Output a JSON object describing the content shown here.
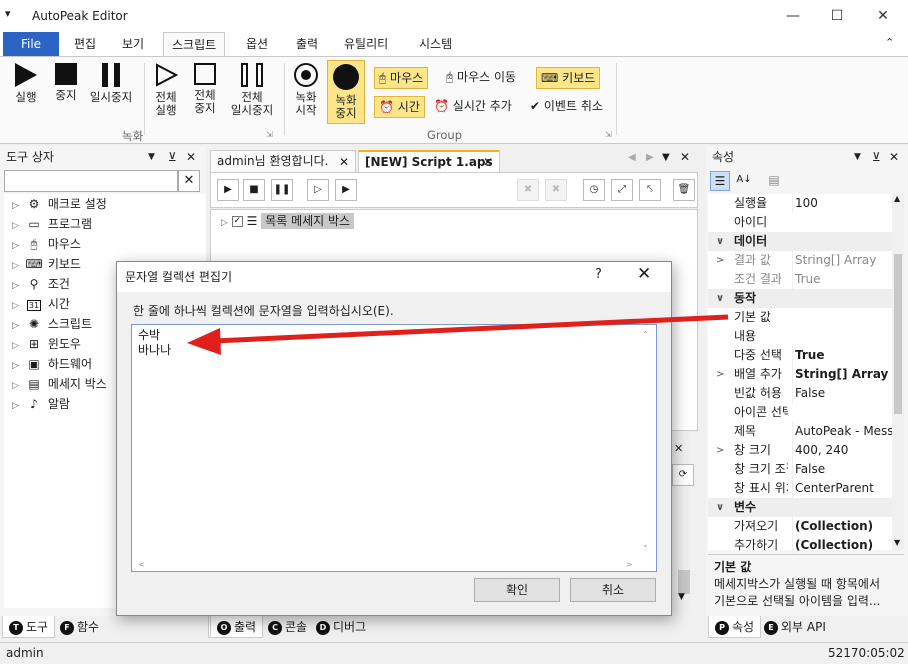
{
  "window": {
    "title": "AutoPeak Editor"
  },
  "ribbon_tabs": [
    "File",
    "편집",
    "보기",
    "스크립트",
    "옵션",
    "출력",
    "유틸리티",
    "시스템"
  ],
  "ribbon": {
    "run": "실행",
    "stop": "중지",
    "pause": "일시중지",
    "run_all_1": "전체",
    "run_all_2": "실행",
    "stop_all_1": "전체",
    "stop_all_2": "중지",
    "pause_all_1": "전체",
    "pause_all_2": "일시중지",
    "record_group_label": "녹화",
    "rec_start_1": "녹화",
    "rec_start_2": "시작",
    "rec_stop_1": "녹화",
    "rec_stop_2": "중지",
    "mouse": "마우스",
    "mouse_move": "마우스 이동",
    "keyboard": "키보드",
    "time": "시간",
    "realtime_add": "실시간 추가",
    "event_cancel": "이벤트 취소",
    "group_label": "Group"
  },
  "left_panel": {
    "title": "도구 상자",
    "items": [
      "매크로 설정",
      "프로그램",
      "마우스",
      "키보드",
      "조건",
      "시간",
      "스크립트",
      "윈도우",
      "하드웨어",
      "메세지 박스",
      "알람"
    ],
    "bottom_tabs": [
      "도구",
      "함수"
    ],
    "calendar_day": "31"
  },
  "document": {
    "tabs": [
      "admin님 환영합니다.",
      "[NEW] Script 1.aps"
    ],
    "tree_item": "목록 메세지 박스",
    "bottom_tabs": [
      "출력",
      "콘솔",
      "디버그"
    ]
  },
  "properties": {
    "title": "속성",
    "rows": [
      {
        "name": "실행율",
        "value": "100"
      },
      {
        "name": "아이디",
        "value": ""
      },
      {
        "category": "데이터"
      },
      {
        "name": "결과 값",
        "value": "String[] Array",
        "gray": true,
        "expand": true
      },
      {
        "name": "조건 결과",
        "value": "True",
        "gray": true
      },
      {
        "category": "동작"
      },
      {
        "name": "기본 값",
        "value": ""
      },
      {
        "name": "내용",
        "value": ""
      },
      {
        "name": "다중 선택",
        "value": "True",
        "bold": true
      },
      {
        "name": "배열 추가",
        "value": "String[] Array",
        "bold": true,
        "expand": true
      },
      {
        "name": "빈값 허용",
        "value": "False"
      },
      {
        "name": "아이콘 선택",
        "value": ""
      },
      {
        "name": "제목",
        "value": "AutoPeak - Message"
      },
      {
        "name": "창 크기",
        "value": "400, 240",
        "expand": true
      },
      {
        "name": "창 크기 조절",
        "value": "False"
      },
      {
        "name": "창 표시 위치",
        "value": "CenterParent"
      },
      {
        "category": "변수"
      },
      {
        "name": "가져오기",
        "value": "(Collection)",
        "bold": true
      },
      {
        "name": "추가하기",
        "value": "(Collection)",
        "bold": true
      }
    ],
    "desc_title": "기본 값",
    "desc_text_1": "메세지박스가 실행될 때 항목에서",
    "desc_text_2": "기본으로 선택될 아이템을 입력...",
    "bottom_tabs": [
      "속성",
      "외부 API"
    ]
  },
  "dialog": {
    "title": "문자열 컬렉션 편집기",
    "help": "?",
    "prompt": "한 줄에 하나씩 컬렉션에 문자열을 입력하십시오(E).",
    "lines": [
      "수박",
      "바나나"
    ],
    "ok": "확인",
    "cancel": "취소"
  },
  "statusbar": {
    "user": "admin",
    "time": "52170:05:02"
  },
  "colors": {
    "file_tab": "#2b64c5",
    "highlight": "#fde68a",
    "active_tab_accent": "#f2b31c",
    "arrow": "#e0201b"
  }
}
